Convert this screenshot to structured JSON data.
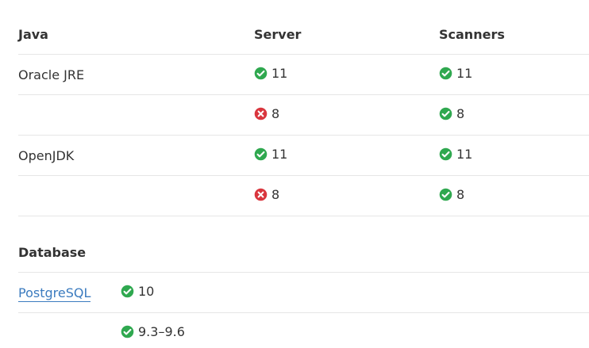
{
  "java": {
    "headers": [
      "Java",
      "Server",
      "Scanners"
    ],
    "rows": [
      {
        "name": "Oracle JRE",
        "server": {
          "status": "ok",
          "version": "11"
        },
        "scanners": {
          "status": "ok",
          "version": "11"
        }
      },
      {
        "name": "",
        "server": {
          "status": "no",
          "version": "8"
        },
        "scanners": {
          "status": "ok",
          "version": "8"
        }
      },
      {
        "name": "OpenJDK",
        "server": {
          "status": "ok",
          "version": "11"
        },
        "scanners": {
          "status": "ok",
          "version": "11"
        }
      },
      {
        "name": "",
        "server": {
          "status": "no",
          "version": "8"
        },
        "scanners": {
          "status": "ok",
          "version": "8"
        }
      }
    ]
  },
  "database": {
    "title": "Database",
    "rows": [
      {
        "name": "PostgreSQL",
        "is_link": true,
        "status": "ok",
        "version": "10"
      },
      {
        "name": "",
        "is_link": false,
        "status": "ok",
        "version": "9.3–9.6"
      }
    ]
  },
  "colors": {
    "ok": "#2fa84f",
    "no": "#d9363e",
    "link": "#3b7bbf",
    "text": "#333333",
    "border": "#e6e6e6"
  },
  "icons": {
    "ok": "check-circle-icon",
    "no": "x-circle-icon"
  }
}
